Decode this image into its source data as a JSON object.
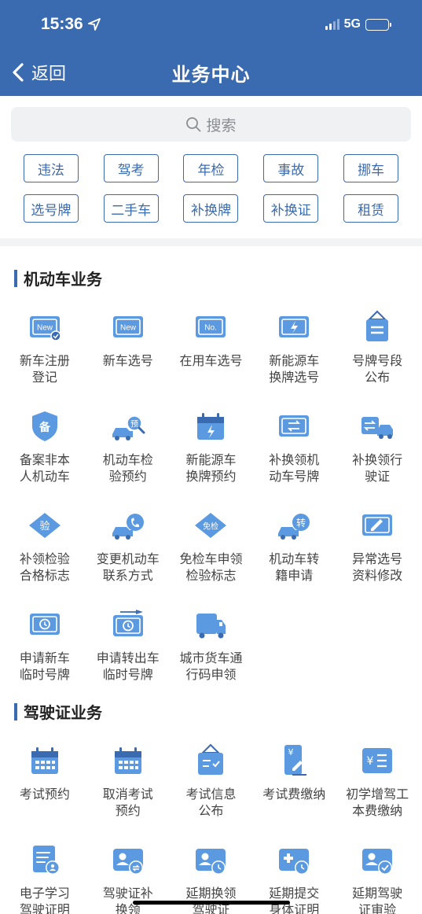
{
  "status_bar": {
    "time": "15:36",
    "network": "5G"
  },
  "nav": {
    "back_label": "返回",
    "title": "业务中心"
  },
  "search": {
    "placeholder": "搜索"
  },
  "tags": [
    "违法",
    "驾考",
    "年检",
    "事故",
    "挪车",
    "选号牌",
    "二手车",
    "补换牌",
    "补换证",
    "租赁"
  ],
  "sections": [
    {
      "title": "机动车业务",
      "items": [
        {
          "icon": "new-plate-register-icon",
          "label": "新车注册登记"
        },
        {
          "icon": "new-plate-select-icon",
          "label": "新车选号"
        },
        {
          "icon": "plate-number-icon",
          "label": "在用车选号"
        },
        {
          "icon": "ev-plate-icon",
          "label": "新能源车换牌选号"
        },
        {
          "icon": "plate-range-notice-icon",
          "label": "号牌号段公布"
        },
        {
          "icon": "filing-shield-icon",
          "label": "备案非本人机动车"
        },
        {
          "icon": "inspection-appointment-icon",
          "label": "机动车检验预约"
        },
        {
          "icon": "ev-calendar-icon",
          "label": "新能源车换牌预约"
        },
        {
          "icon": "plate-swap-icon",
          "label": "补换领机动车号牌"
        },
        {
          "icon": "car-license-swap-icon",
          "label": "补换领行驶证"
        },
        {
          "icon": "inspection-diamond-icon",
          "label": "补领检验合格标志"
        },
        {
          "icon": "car-phone-icon",
          "label": "变更机动车联系方式"
        },
        {
          "icon": "exempt-inspection-icon",
          "label": "免检车申领检验标志"
        },
        {
          "icon": "car-transfer-icon",
          "label": "机动车转籍申请"
        },
        {
          "icon": "plate-edit-icon",
          "label": "异常选号资料修改"
        },
        {
          "icon": "temp-plate-clock-icon",
          "label": "申请新车临时号牌"
        },
        {
          "icon": "temp-plate-out-icon",
          "label": "申请转出车临时号牌"
        },
        {
          "icon": "truck-pass-icon",
          "label": "城市货车通行码申领"
        }
      ]
    },
    {
      "title": "驾驶证业务",
      "items": [
        {
          "icon": "exam-calendar-icon",
          "label": "考试预约"
        },
        {
          "icon": "cancel-exam-calendar-icon",
          "label": "取消考试预约"
        },
        {
          "icon": "exam-notice-icon",
          "label": "考试信息公布"
        },
        {
          "icon": "exam-fee-icon",
          "label": "考试费缴纳"
        },
        {
          "icon": "fee-list-icon",
          "label": "初学增驾工本费缴纳"
        },
        {
          "icon": "e-study-icon",
          "label": "电子学习驾驶证明"
        },
        {
          "icon": "license-swap-icon",
          "label": "驾驶证补换领"
        },
        {
          "icon": "license-delay-icon",
          "label": "延期换领驾驶证"
        },
        {
          "icon": "license-health-icon",
          "label": "延期提交身体证明"
        },
        {
          "icon": "license-verify-icon",
          "label": "延期驾驶证审验"
        }
      ]
    }
  ]
}
